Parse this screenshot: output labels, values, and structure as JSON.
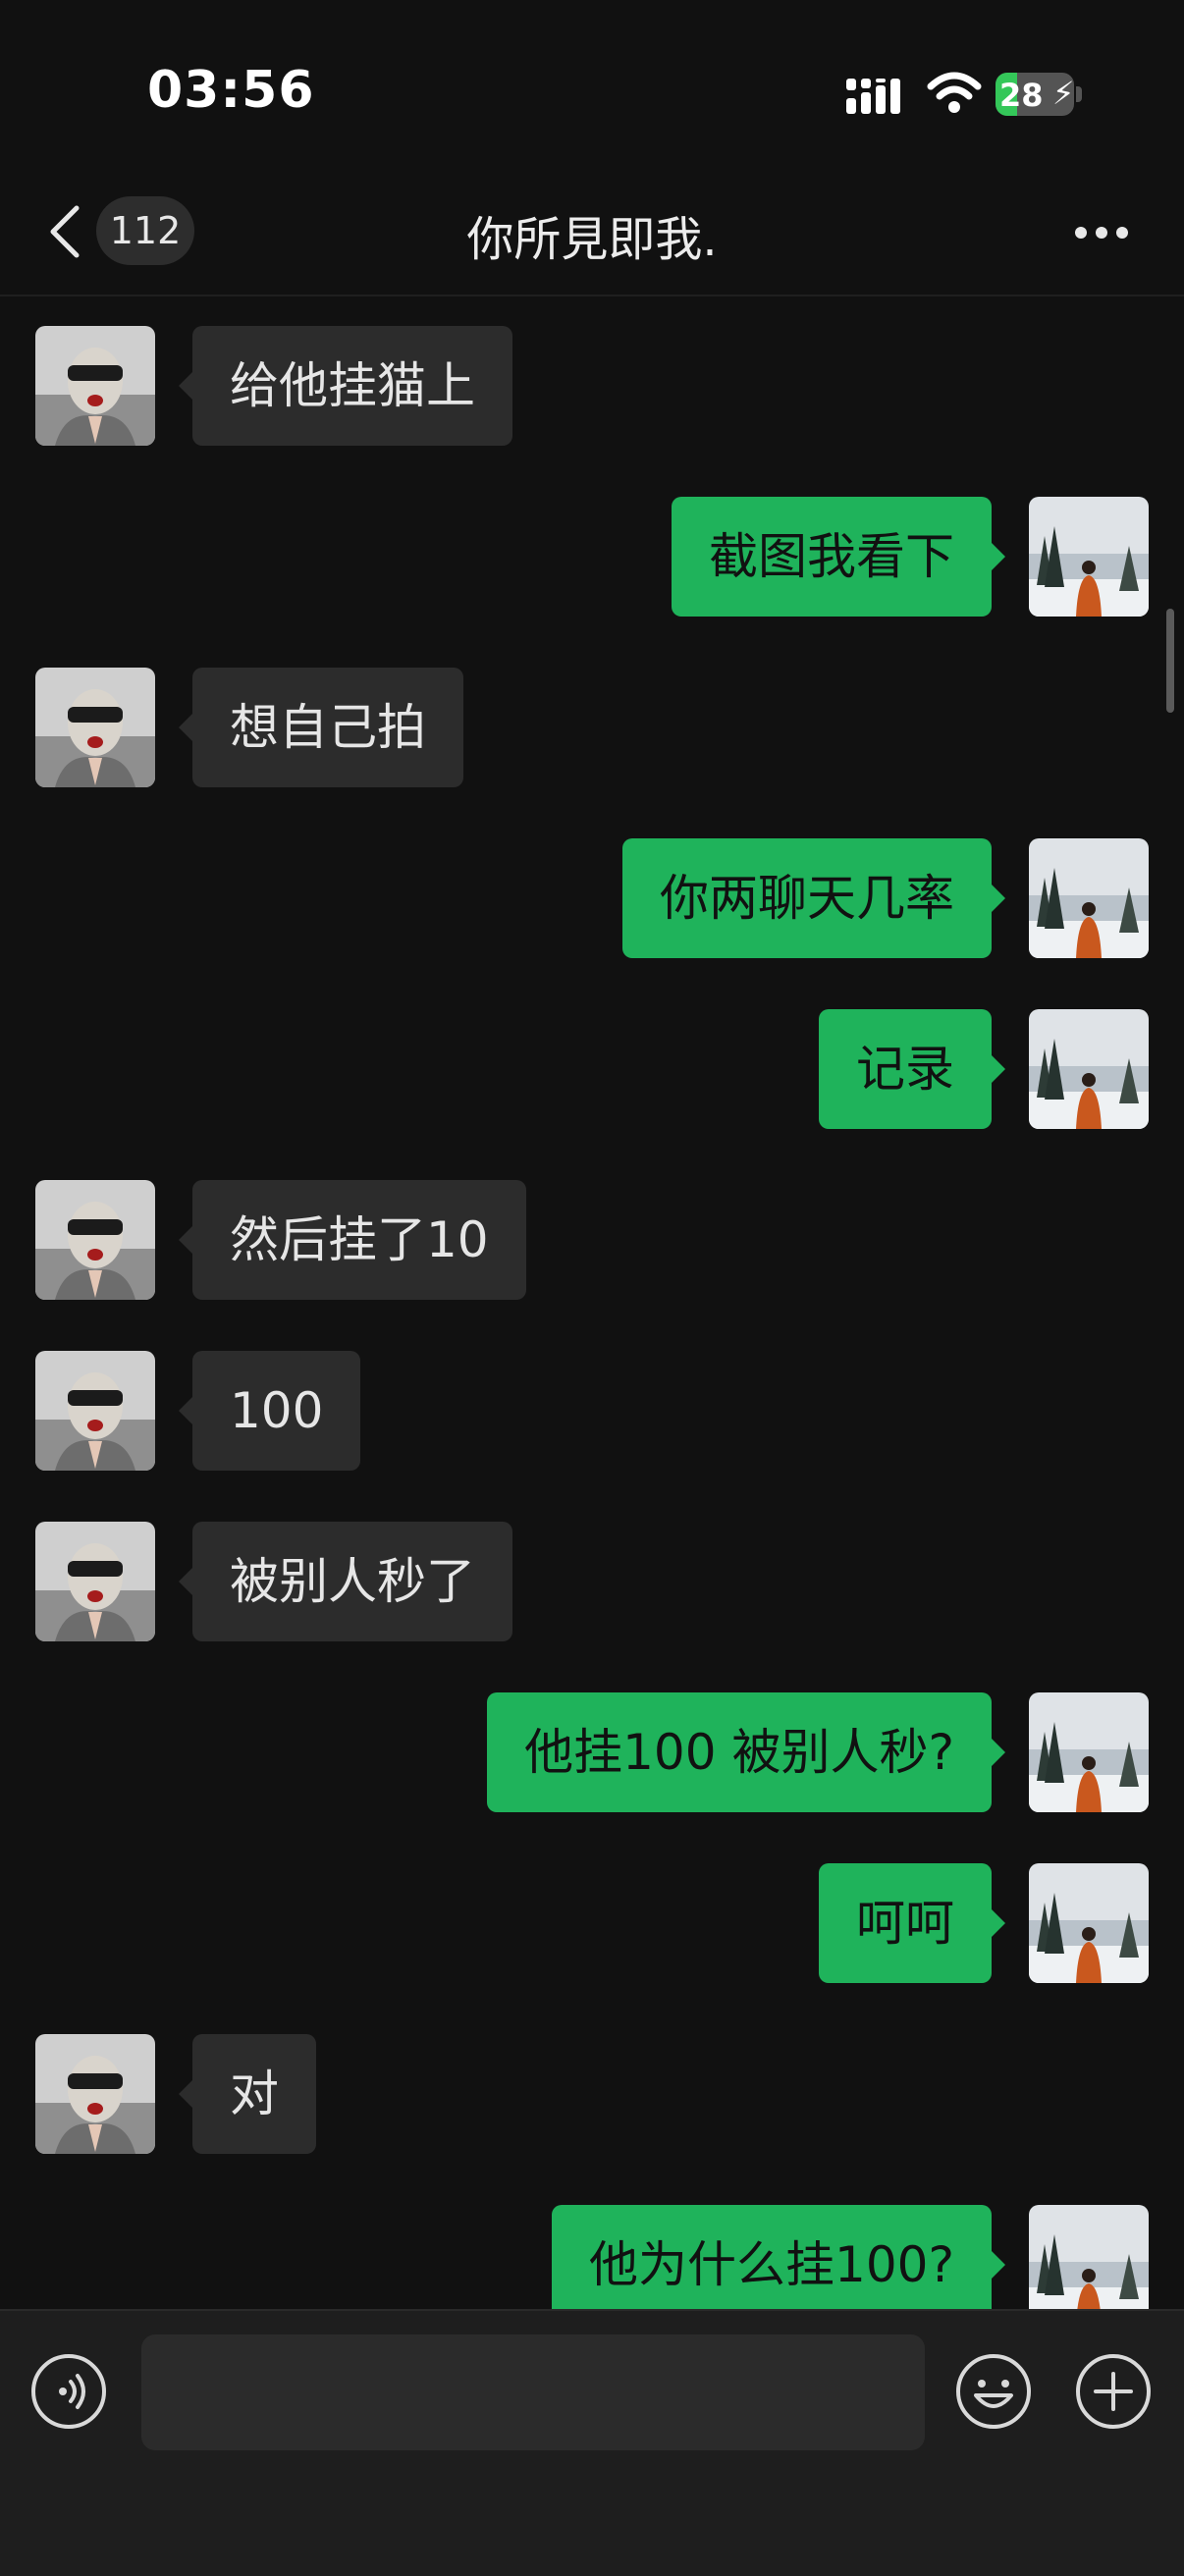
{
  "status_bar": {
    "time": "03:56",
    "battery": "28",
    "battery_level": 0.28
  },
  "header": {
    "back_count": "112",
    "title": "你所見即我."
  },
  "messages": [
    {
      "side": "left",
      "text": "给他挂猫上"
    },
    {
      "side": "right",
      "text": "截图我看下"
    },
    {
      "side": "left",
      "text": "想自己拍"
    },
    {
      "side": "right",
      "text": "你两聊天几率"
    },
    {
      "side": "right",
      "text": "记录"
    },
    {
      "side": "left",
      "text": "然后挂了10"
    },
    {
      "side": "left",
      "text": "100"
    },
    {
      "side": "left",
      "text": "被别人秒了"
    },
    {
      "side": "right",
      "text": "他挂100 被别人秒?"
    },
    {
      "side": "right",
      "text": "呵呵"
    },
    {
      "side": "left",
      "text": "对"
    },
    {
      "side": "right",
      "text": "他为什么挂100?"
    }
  ],
  "input": {
    "value": "",
    "placeholder": ""
  },
  "colors": {
    "background": "#111111",
    "bubble_self": "#1fb35b",
    "bubble_other": "#2c2c2c",
    "input_bar": "#1e1e1e"
  },
  "icons": {
    "back": "chevron-left-icon",
    "more": "more-icon",
    "voice": "voice-icon",
    "emoji": "emoji-icon",
    "plus": "plus-icon"
  }
}
